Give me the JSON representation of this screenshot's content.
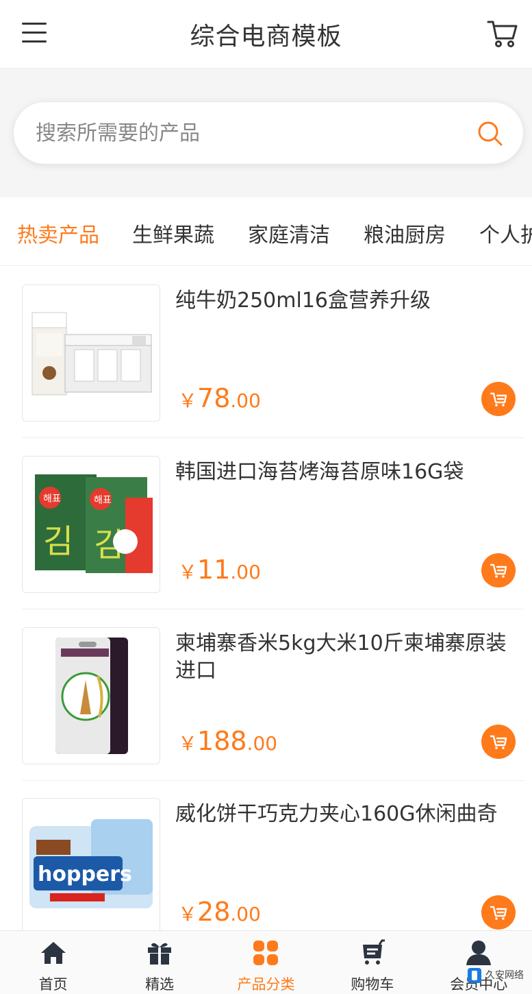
{
  "header": {
    "title": "综合电商模板",
    "menu_icon": "hamburger-menu-icon",
    "cart_icon": "shopping-cart-icon"
  },
  "search": {
    "placeholder": "搜索所需要的产品",
    "value": "",
    "icon": "search-icon"
  },
  "tabs": [
    {
      "label": "热卖产品",
      "active": true
    },
    {
      "label": "生鲜果蔬",
      "active": false
    },
    {
      "label": "家庭清洁",
      "active": false
    },
    {
      "label": "粮油厨房",
      "active": false
    },
    {
      "label": "个人护",
      "active": false
    }
  ],
  "products": [
    {
      "name": "纯牛奶250ml16盒营养升级",
      "currency": "￥",
      "price_int": "78",
      "price_dec": ".00",
      "image": "milk-box-image"
    },
    {
      "name": "韩国进口海苔烤海苔原味16G袋",
      "currency": "￥",
      "price_int": "11",
      "price_dec": ".00",
      "image": "seaweed-pack-image"
    },
    {
      "name": "柬埔寨香米5kg大米10斤柬埔寨原装进口",
      "currency": "￥",
      "price_int": "188",
      "price_dec": ".00",
      "image": "rice-bag-image"
    },
    {
      "name": "威化饼干巧克力夹心160G休闲曲奇",
      "currency": "￥",
      "price_int": "28",
      "price_dec": ".00",
      "image": "wafer-pack-image"
    }
  ],
  "bottom_nav": [
    {
      "label": "首页",
      "icon": "home-icon",
      "active": false
    },
    {
      "label": "精选",
      "icon": "gift-icon",
      "active": false
    },
    {
      "label": "产品分类",
      "icon": "grid-icon",
      "active": true
    },
    {
      "label": "购物车",
      "icon": "cart-icon",
      "active": false
    },
    {
      "label": "会员中心",
      "icon": "user-icon",
      "active": false
    }
  ],
  "watermark": {
    "text": "久安网络"
  },
  "colors": {
    "accent": "#ff7a1a",
    "text": "#333333",
    "divider": "#eeeeee"
  }
}
